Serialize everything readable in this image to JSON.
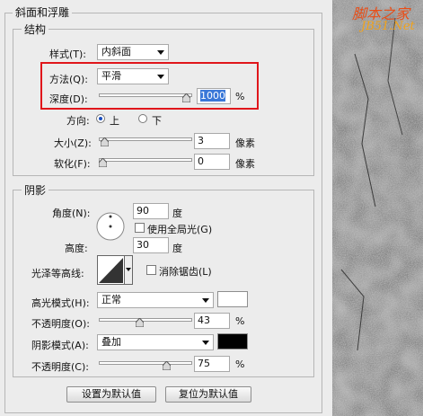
{
  "panel_title": "斜面和浮雕",
  "structure": {
    "legend": "结构",
    "style": {
      "label": "样式(T):",
      "value": "内斜面"
    },
    "method": {
      "label": "方法(Q):",
      "value": "平滑"
    },
    "depth": {
      "label": "深度(D):",
      "value": "1000",
      "unit": "%",
      "slider_fraction": 0.98
    },
    "direction": {
      "label": "方向:",
      "options": [
        "上",
        "下"
      ],
      "selected": "上"
    },
    "size": {
      "label": "大小(Z):",
      "value": "3",
      "unit": "像素",
      "slider_fraction": 0.02
    },
    "soften": {
      "label": "软化(F):",
      "value": "0",
      "unit": "像素",
      "slider_fraction": 0.0
    }
  },
  "shading": {
    "legend": "阴影",
    "angle": {
      "label": "角度(N):",
      "value": "90",
      "unit": "度"
    },
    "global_light": {
      "label": "使用全局光(G)",
      "checked": false
    },
    "altitude": {
      "label": "高度:",
      "value": "30",
      "unit": "度"
    },
    "gloss_contour": {
      "label": "光泽等高线:"
    },
    "anti_aliased": {
      "label": "消除锯齿(L)",
      "checked": false
    },
    "highlight_mode": {
      "label": "高光模式(H):",
      "value": "正常",
      "color": "#ffffff"
    },
    "highlight_opacity": {
      "label": "不透明度(O):",
      "value": "43",
      "unit": "%",
      "slider_fraction": 0.43
    },
    "shadow_mode": {
      "label": "阴影模式(A):",
      "value": "叠加",
      "color": "#000000"
    },
    "shadow_opacity": {
      "label": "不透明度(C):",
      "value": "75",
      "unit": "%",
      "slider_fraction": 0.75
    }
  },
  "buttons": {
    "set_default": "设置为默认值",
    "reset_default": "复位为默认值"
  },
  "watermark": {
    "line1": "脚本之家",
    "line2": "JB51.Net"
  },
  "colors": {
    "highlight_box": "#e0161b",
    "accent": "#3a78d8"
  }
}
